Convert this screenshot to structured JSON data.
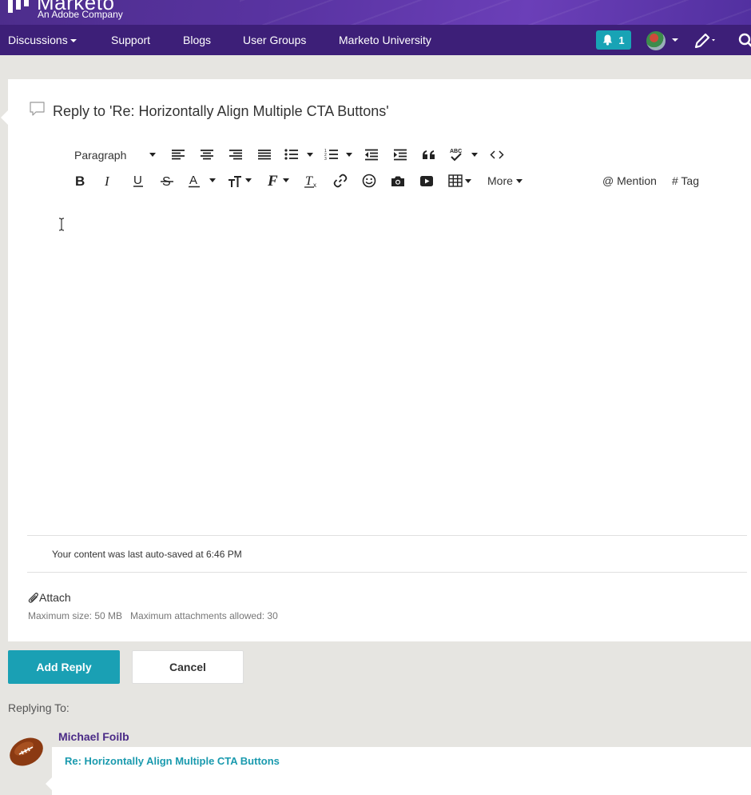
{
  "brand": {
    "name": "Marketo",
    "tagline": "An Adobe Company",
    "colors": {
      "band": "#5a34a3",
      "nav": "#3d1f78",
      "accent": "#1aa0b4"
    }
  },
  "nav": {
    "items": [
      {
        "label": "Discussions",
        "has_caret": true
      },
      {
        "label": "Support"
      },
      {
        "label": "Blogs"
      },
      {
        "label": "User Groups"
      },
      {
        "label": "Marketo University"
      }
    ],
    "notification_count": "1",
    "icons": [
      "bell-icon",
      "avatar",
      "pencil-icon",
      "search-icon"
    ]
  },
  "editor": {
    "title": "Reply to 'Re: Horizontally Align Multiple CTA Buttons'",
    "paragraph_select": "Paragraph",
    "more_label": "More",
    "mention_label": "@ Mention",
    "tag_label": "# Tag",
    "spellcheck_glyph": "ABC",
    "autosave_text": "Your content was last auto-saved at 6:46 PM",
    "attach_label": "Attach",
    "limits_text": "Maximum size: 50 MB   Maximum attachments allowed: 30"
  },
  "actions": {
    "add_reply": "Add Reply",
    "cancel": "Cancel"
  },
  "replying_to": {
    "label": "Replying To:",
    "author": "Michael Foilb",
    "subject": "Re: Horizontally Align Multiple CTA Buttons"
  }
}
